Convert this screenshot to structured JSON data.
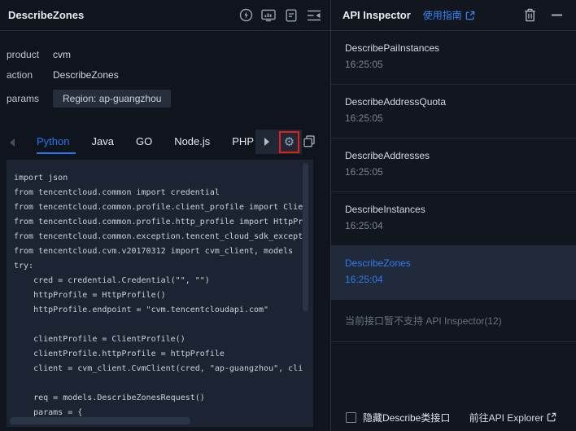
{
  "colors": {
    "accent_blue": "#2478f2",
    "link_blue": "#3586f5",
    "annotation_red": "#e01f1f",
    "code_bg": "#1c2332",
    "selected_row_bg": "#212a3a",
    "panel_bg": "#10141d"
  },
  "icons": {
    "left_header": [
      "lightning-circle-icon",
      "console-icon",
      "document-icon",
      "collapse-panel-icon"
    ],
    "tab_controls": [
      "scroll-left-icon",
      "scroll-right-icon",
      "gear-icon",
      "copy-icon"
    ],
    "right_header": [
      "external-link-icon",
      "trash-icon",
      "minimize-icon"
    ],
    "footer": [
      "checkbox",
      "external-link-icon"
    ]
  },
  "left_panel": {
    "title": "DescribeZones",
    "meta": [
      {
        "label": "product",
        "value": "cvm"
      },
      {
        "label": "action",
        "value": "DescribeZones"
      },
      {
        "label": "params",
        "value": "Region: ap-guangzhou"
      }
    ],
    "tabs": [
      "Python",
      "Java",
      "GO",
      "Node.js",
      "PHP"
    ],
    "active_tab": "Python",
    "code": [
      "import json",
      "from tencentcloud.common import credential",
      "from tencentcloud.common.profile.client_profile import Clie",
      "from tencentcloud.common.profile.http_profile import HttpPr",
      "from tencentcloud.common.exception.tencent_cloud_sdk_except",
      "from tencentcloud.cvm.v20170312 import cvm_client, models",
      "try:",
      "    cred = credential.Credential(\"\", \"\")",
      "    httpProfile = HttpProfile()",
      "    httpProfile.endpoint = \"cvm.tencentcloudapi.com\"",
      "",
      "    clientProfile = ClientProfile()",
      "    clientProfile.httpProfile = httpProfile",
      "    client = cvm_client.CvmClient(cred, \"ap-guangzhou\", cli",
      "",
      "    req = models.DescribeZonesRequest()",
      "    params = {"
    ]
  },
  "right_panel": {
    "title": "API Inspector",
    "guide_link": "使用指南",
    "items": [
      {
        "name": "DescribePaiInstances",
        "time": "16:25:05"
      },
      {
        "name": "DescribeAddressQuota",
        "time": "16:25:05"
      },
      {
        "name": "DescribeAddresses",
        "time": "16:25:05"
      },
      {
        "name": "DescribeInstances",
        "time": "16:25:04"
      },
      {
        "name": "DescribeZones",
        "time": "16:25:04"
      }
    ],
    "selected_item": "DescribeZones",
    "notice": "当前接口暂不支持 API Inspector(12)",
    "footer": {
      "hide_checkbox_label": "隐藏Describe类接口",
      "explorer_link": "前往API Explorer"
    }
  }
}
